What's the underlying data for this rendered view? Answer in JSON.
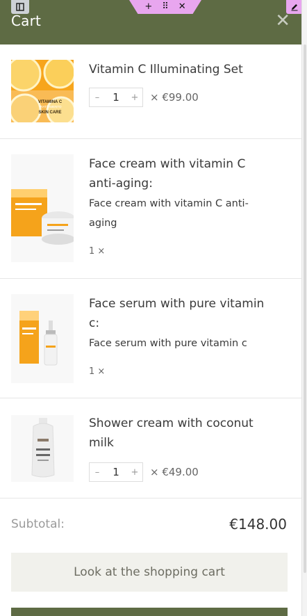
{
  "header": {
    "title": "Cart",
    "close_glyph": "✕",
    "accent_color": "#5e6b44"
  },
  "editor_toolbar": {
    "add_glyph": "+",
    "drag_glyph": "⠿",
    "remove_glyph": "✕"
  },
  "items": [
    {
      "name": "Vitamin C Illuminating Set",
      "quantity": "1",
      "price": "× €99.00",
      "image_text": [
        "VITAMINA C",
        "ILLUMINANTE",
        "SKIN CARE"
      ],
      "editable_qty": true
    },
    {
      "name_line1": "Face cream with vitamin C",
      "name_line2": "anti-aging:",
      "desc_line1": "Face cream with vitamin C anti-",
      "desc_line2": "aging",
      "quantity_text": "1 ×"
    },
    {
      "name_line1": "Face serum with pure vitamin",
      "name_line2": "c:",
      "desc_line1": "Face serum with pure vitamin c",
      "quantity_text": "1 ×"
    },
    {
      "name_line1": "Shower cream with coconut",
      "name_line2": "milk",
      "quantity": "1",
      "price": "× €49.00"
    }
  ],
  "qty_controls": {
    "minus": "–",
    "plus": "+"
  },
  "subtotal": {
    "label": "Subtotal:",
    "value": "€148.00"
  },
  "buttons": {
    "view_cart": "Look at the shopping cart"
  }
}
